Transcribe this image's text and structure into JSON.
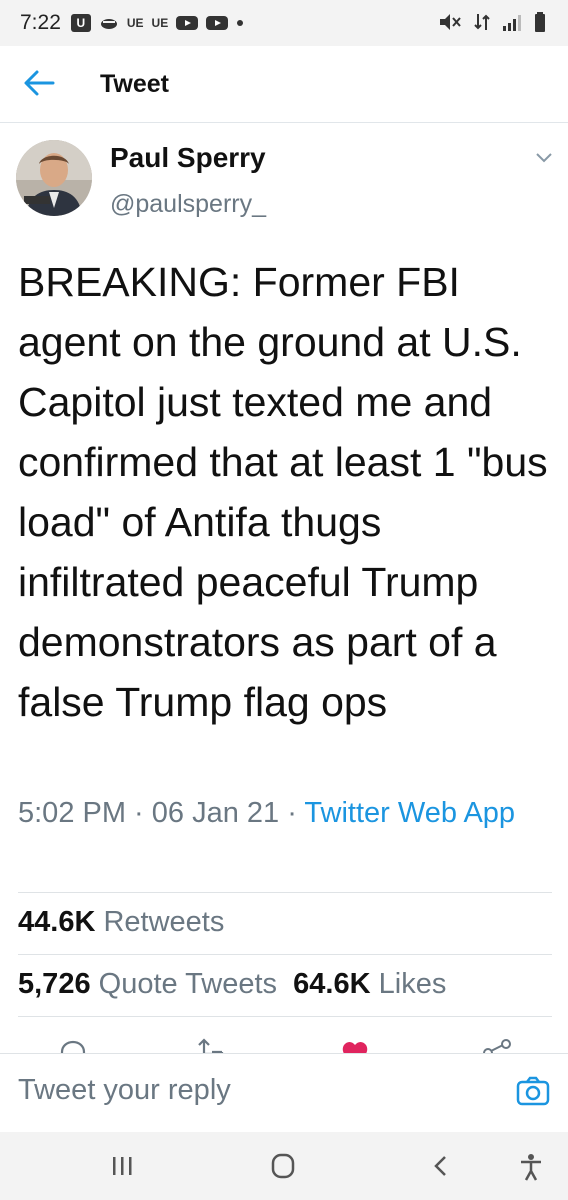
{
  "status_bar": {
    "time": "7:22",
    "notif_u": "U",
    "notif_ue1": "UE",
    "notif_ue2": "UE"
  },
  "topbar": {
    "title": "Tweet"
  },
  "tweet": {
    "author_name": "Paul Sperry",
    "author_handle": "@paulsperry_",
    "text": "BREAKING: Former FBI agent on the ground at U.S. Capitol just texted me and confirmed that at least 1 \"bus load\" of Antifa thugs infiltrated peaceful Trump demonstrators as part of a false Trump flag ops",
    "time": "5:02 PM",
    "sep1": " · ",
    "date": "06 Jan 21",
    "sep2": " · ",
    "source": "Twitter Web App"
  },
  "stats": {
    "retweets_count": "44.6K",
    "retweets_label": "Retweets",
    "quotes_count": "5,726",
    "quotes_label": "Quote Tweets",
    "likes_count": "64.6K",
    "likes_label": "Likes"
  },
  "reply": {
    "placeholder": "Tweet your reply"
  },
  "colors": {
    "accent": "#1b95e0",
    "like": "#e0245e",
    "muted": "#6a7782"
  }
}
